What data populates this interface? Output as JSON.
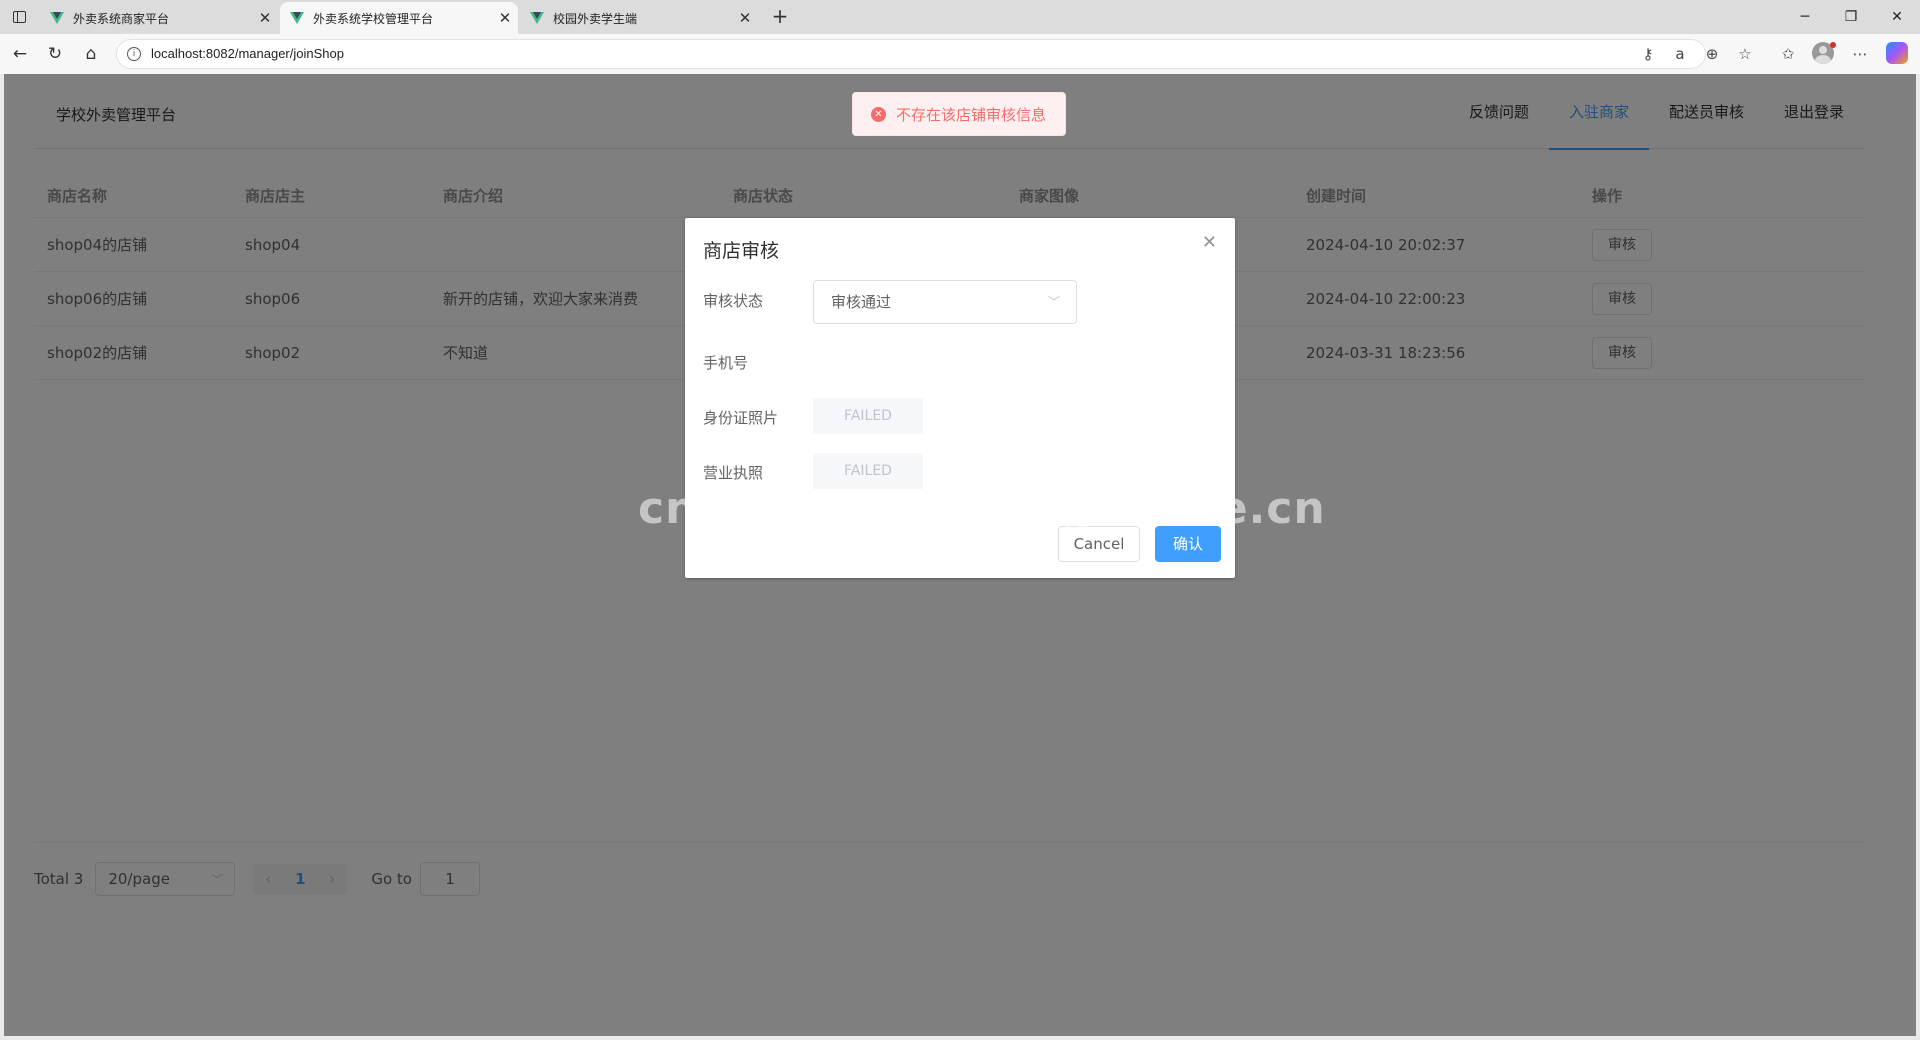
{
  "browser": {
    "tabs": [
      {
        "title": "外卖系统商家平台"
      },
      {
        "title": "外卖系统学校管理平台"
      },
      {
        "title": "校园外卖学生端"
      }
    ],
    "url": "localhost:8082/manager/joinShop"
  },
  "header": {
    "brand": "学校外卖管理平台",
    "menu": [
      "反馈问题",
      "入驻商家",
      "配送员审核",
      "退出登录"
    ],
    "active_menu": "入驻商家"
  },
  "table": {
    "columns": [
      "商店名称",
      "商店店主",
      "商店介绍",
      "商店状态",
      "商家图像",
      "创建时间",
      "操作"
    ],
    "rows": [
      {
        "name": "shop04的店铺",
        "owner": "shop04",
        "intro": "",
        "created": "2024-04-10 20:02:37",
        "action": "审核"
      },
      {
        "name": "shop06的店铺",
        "owner": "shop06",
        "intro": "新开的店铺，欢迎大家来消费",
        "created": "2024-04-10 22:00:23",
        "action": "审核"
      },
      {
        "name": "shop02的店铺",
        "owner": "shop02",
        "intro": "不知道",
        "created": "2024-03-31 18:23:56",
        "action": "审核"
      }
    ]
  },
  "pagination": {
    "total": "Total 3",
    "page_size": "20/page",
    "current_page": "1",
    "goto_label": "Go to",
    "goto_value": "1"
  },
  "message": {
    "text": "不存在该店铺审核信息",
    "type": "error",
    "color": "#f56c6c"
  },
  "dialog": {
    "title": "商店审核",
    "fields": {
      "status_label": "审核状态",
      "status_value": "审核通过",
      "phone_label": "手机号",
      "id_photo_label": "身份证照片",
      "id_photo_value": "FAILED",
      "license_label": "营业执照",
      "license_value": "FAILED"
    },
    "cancel_label": "Cancel",
    "confirm_label": "确认"
  },
  "watermark": "cn围观客www.weiguanke.cn",
  "colors": {
    "primary": "#409eff",
    "danger": "#f56c6c"
  }
}
